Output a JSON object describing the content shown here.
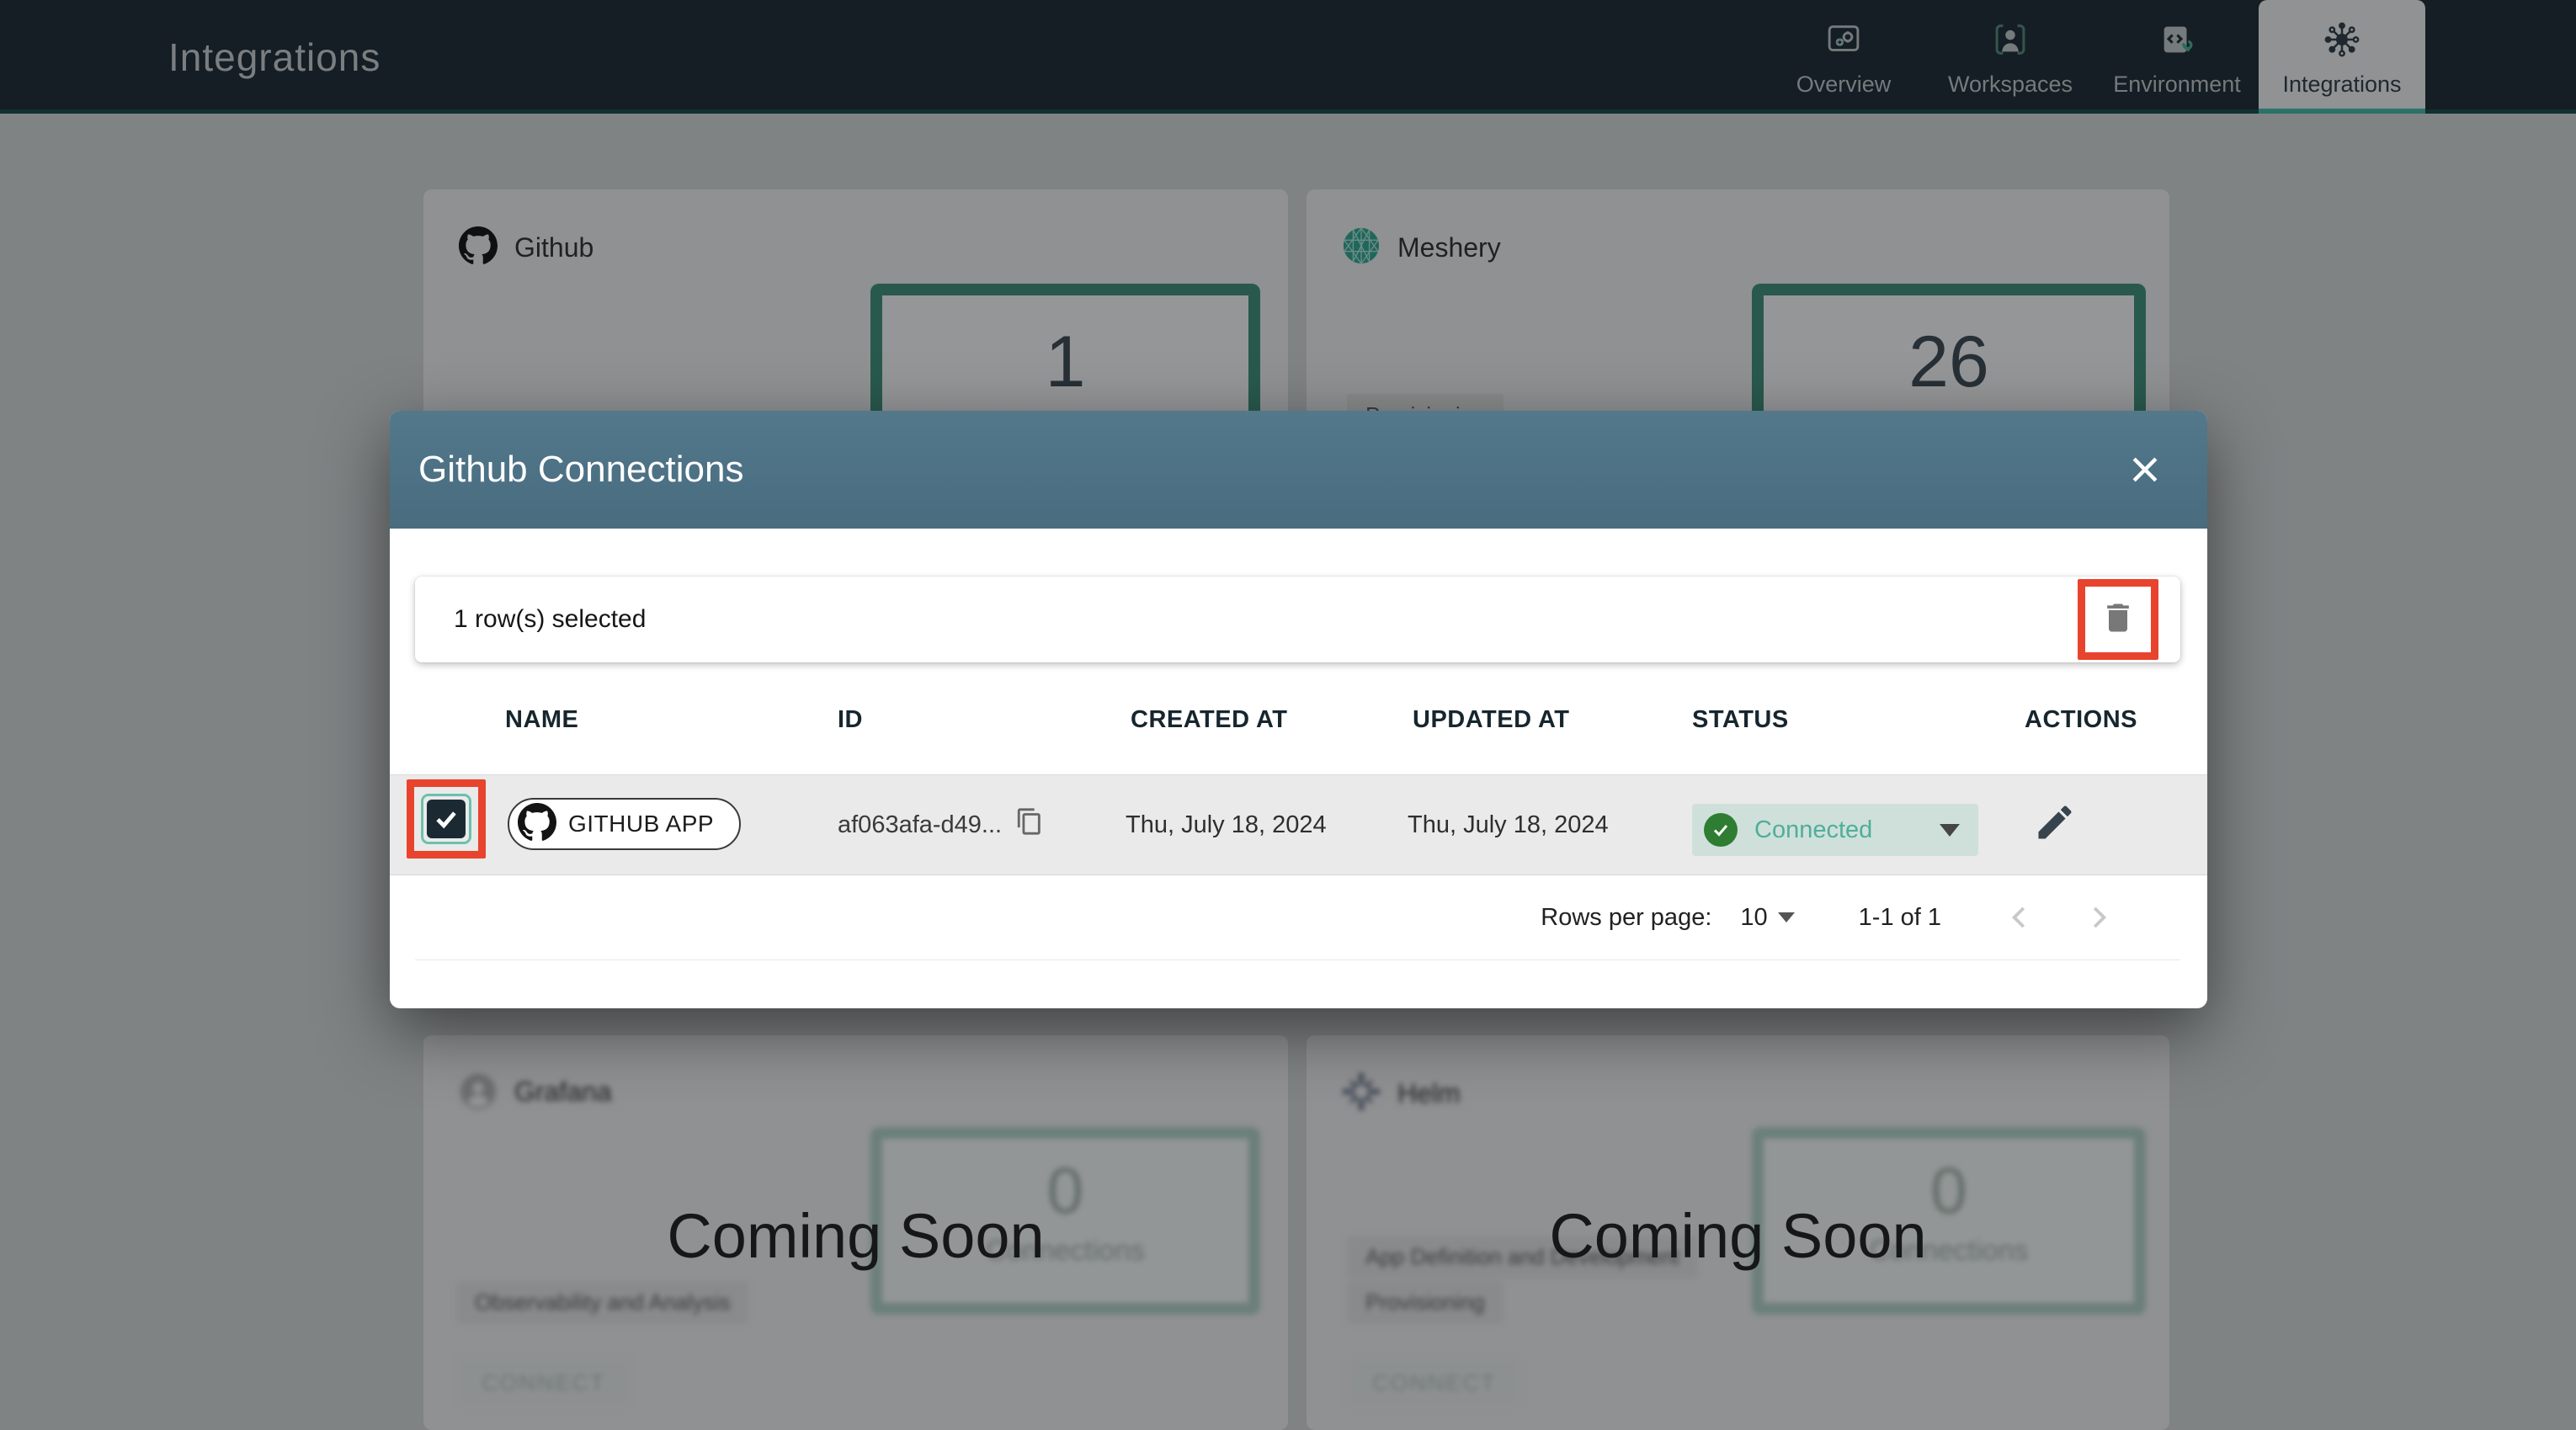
{
  "navbar": {
    "title": "Integrations",
    "tabs": [
      {
        "label": "Overview",
        "icon": "overview-icon",
        "active": false
      },
      {
        "label": "Workspaces",
        "icon": "workspaces-icon",
        "active": false
      },
      {
        "label": "Environment",
        "icon": "environment-icon",
        "active": false
      },
      {
        "label": "Integrations",
        "icon": "integrations-icon",
        "active": true
      }
    ]
  },
  "strings": {
    "connections_label": "Connections",
    "coming_soon": "Coming Soon",
    "connect": "CONNECT"
  },
  "cards": [
    {
      "name": "Github",
      "icon": "github-octocat-icon",
      "connections": "1",
      "badges": []
    },
    {
      "name": "Meshery",
      "icon": "meshery-mesh-icon",
      "connections": "26",
      "badges": [
        "Provisioning"
      ]
    },
    {
      "name": "Grafana",
      "icon": "avatar-placeholder-icon",
      "connections": "0",
      "badges": [
        "Observability and Analysis"
      ],
      "coming_soon": true
    },
    {
      "name": "Helm",
      "icon": "helm-wheel-icon",
      "connections": "0",
      "badges": [
        "App Definition and Development",
        "Provisioning"
      ],
      "coming_soon": true
    }
  ],
  "modal": {
    "title": "Github Connections",
    "toolbar": {
      "selection_text": "1 row(s) selected",
      "delete_icon": "trash-icon"
    },
    "table": {
      "headers": [
        "NAME",
        "ID",
        "CREATED AT",
        "UPDATED AT",
        "STATUS",
        "ACTIONS"
      ],
      "row": {
        "name": "GITHUB APP",
        "id": "af063afa-d49...",
        "created": "Thu, July 18, 2024",
        "updated": "Thu, July 18, 2024",
        "status": "Connected",
        "selected": true
      }
    },
    "pagination": {
      "rows_per_page_label": "Rows per page:",
      "rows_per_page": "10",
      "range": "1-1 of 1"
    }
  },
  "colors": {
    "navbar_bg": "#1C2B33",
    "accent_teal": "#53B3A2",
    "modal_header_blue": "#4F7488",
    "highlight_red": "#E8432D",
    "status_green": "#2E7D32",
    "status_text_teal": "#4FAE9A",
    "status_pill_bg": "#CFE0DA",
    "count_border_teal": "#3E8A74"
  },
  "icons": [
    "overview-icon",
    "workspaces-icon",
    "environment-icon",
    "integrations-icon",
    "github-octocat-icon",
    "meshery-mesh-icon",
    "avatar-placeholder-icon",
    "helm-wheel-icon",
    "close-icon",
    "trash-icon",
    "checkbox-check-icon",
    "copy-icon",
    "check-circle-icon",
    "dropdown-caret-icon",
    "edit-pencil-icon",
    "chevron-left-icon",
    "chevron-right-icon"
  ]
}
